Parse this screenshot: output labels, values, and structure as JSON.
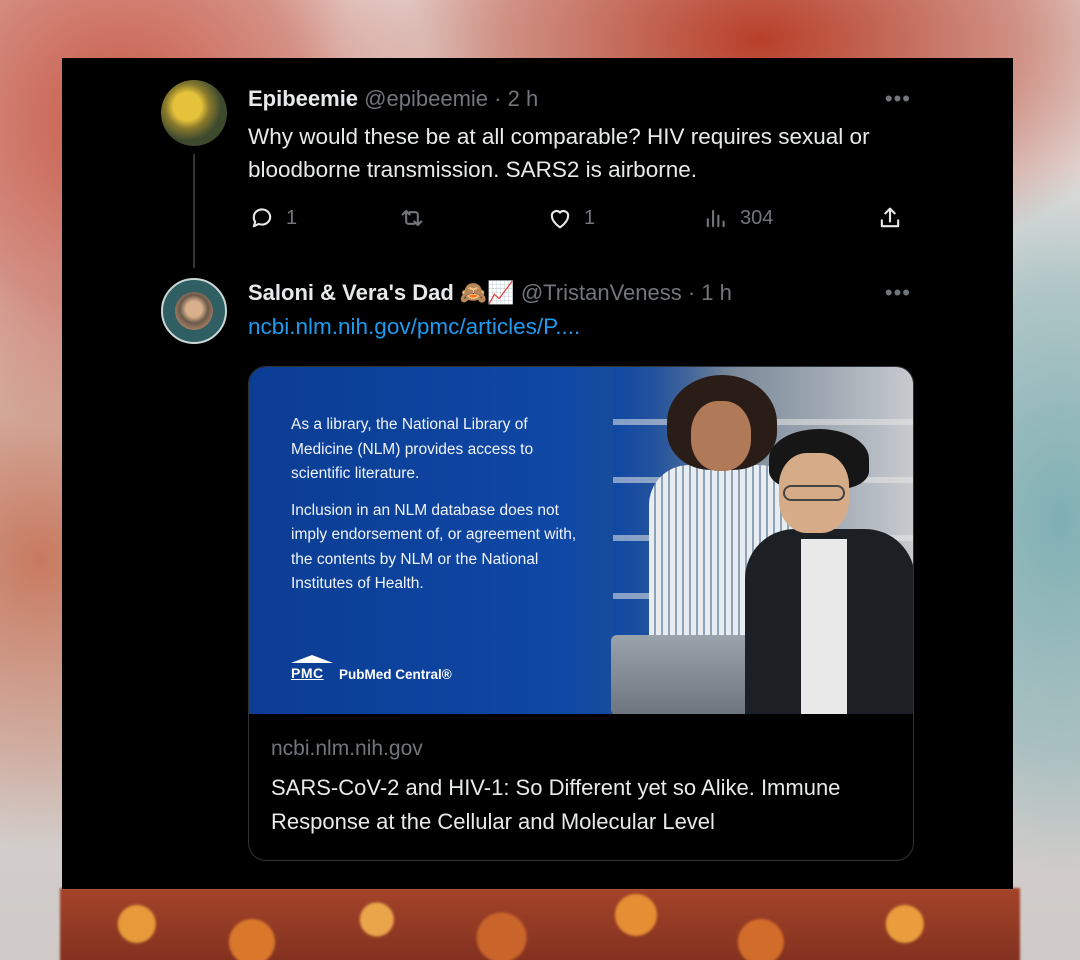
{
  "tweet1": {
    "display_name": "Epibeemie",
    "handle": "@epibeemie",
    "separator": " · ",
    "time": "2 h",
    "text": "Why would these be at all comparable? HIV requires sexual or bloodborne transmission. SARS2 is airborne.",
    "more_label": "•••",
    "replies": "1",
    "retweets": "",
    "likes": "1",
    "views": "304"
  },
  "tweet2": {
    "display_name": "Saloni & Vera's Dad",
    "emoji": "🙈📈",
    "handle": "@TristanVeness",
    "separator": " · ",
    "time": "1 h",
    "more_label": "•••",
    "link_text": "ncbi.nlm.nih.gov/pmc/articles/P....",
    "card": {
      "notice_p1": "As a library, the National Library of Medicine (NLM) provides access to scientific literature.",
      "notice_p2": "Inclusion in an NLM database does not imply endorsement of, or agreement with, the contents by NLM or the National Institutes of Health.",
      "logo_mark": "PMC",
      "logo_name": "PubMed Central®",
      "domain": "ncbi.nlm.nih.gov",
      "title": "SARS-CoV-2 and HIV-1: So Different yet so Alike. Immune Response at the Cellular and Molecular Level"
    }
  },
  "colors": {
    "background": "#000000",
    "primary_text": "#e7e9ea",
    "secondary_text": "#71767b",
    "link": "#1d9bf0",
    "card_blue": "#0f48a6"
  },
  "icons": [
    "reply-icon",
    "retweet-icon",
    "like-icon",
    "views-icon",
    "share-icon",
    "more-icon"
  ]
}
